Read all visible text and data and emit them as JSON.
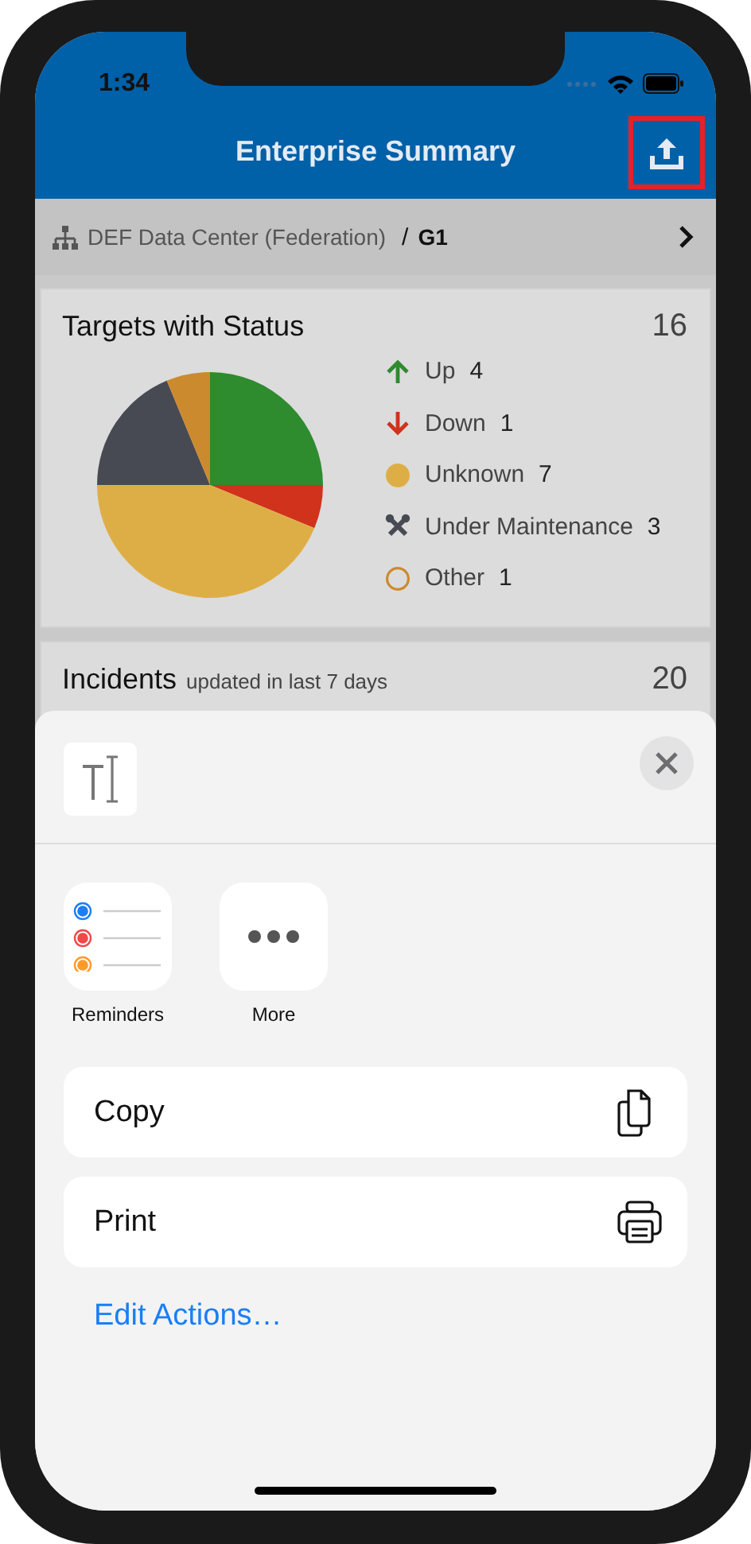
{
  "status_bar": {
    "time": "1:34"
  },
  "header": {
    "title": "Enterprise Summary"
  },
  "breadcrumb": {
    "parent": "DEF Data Center (Federation)",
    "separator": "/",
    "current": "G1"
  },
  "targets_card": {
    "title": "Targets with Status",
    "total": "16",
    "legend": [
      {
        "kind": "up",
        "count": "4",
        "color": "#2e8b2e"
      },
      {
        "kind": "down",
        "count": "1",
        "color": "#d0321c"
      },
      {
        "kind": "unknown",
        "count": "7",
        "color": "#deae46"
      },
      {
        "kind": "maintenance",
        "count": "3",
        "color": "#474a52"
      },
      {
        "kind": "other",
        "count": "1",
        "color": "#cc8a2f"
      }
    ],
    "chart_data": {
      "type": "pie",
      "categories": [
        "Up",
        "Down",
        "Unknown",
        "Under Maintenance",
        "Other"
      ],
      "values": [
        25,
        6.25,
        43.75,
        18.75,
        6.25
      ]
    }
  },
  "incidents_card": {
    "title": "Incidents",
    "subtitle": "updated in last 7 days",
    "total": "20"
  },
  "share_sheet": {
    "apps": [
      {
        "kind": "reminders",
        "label": "Reminders"
      },
      {
        "kind": "more",
        "label": "More"
      }
    ],
    "actions": [
      {
        "kind": "copy",
        "label": "Copy"
      },
      {
        "kind": "print",
        "label": "Print"
      }
    ],
    "edit_link": "Edit Actions…"
  }
}
